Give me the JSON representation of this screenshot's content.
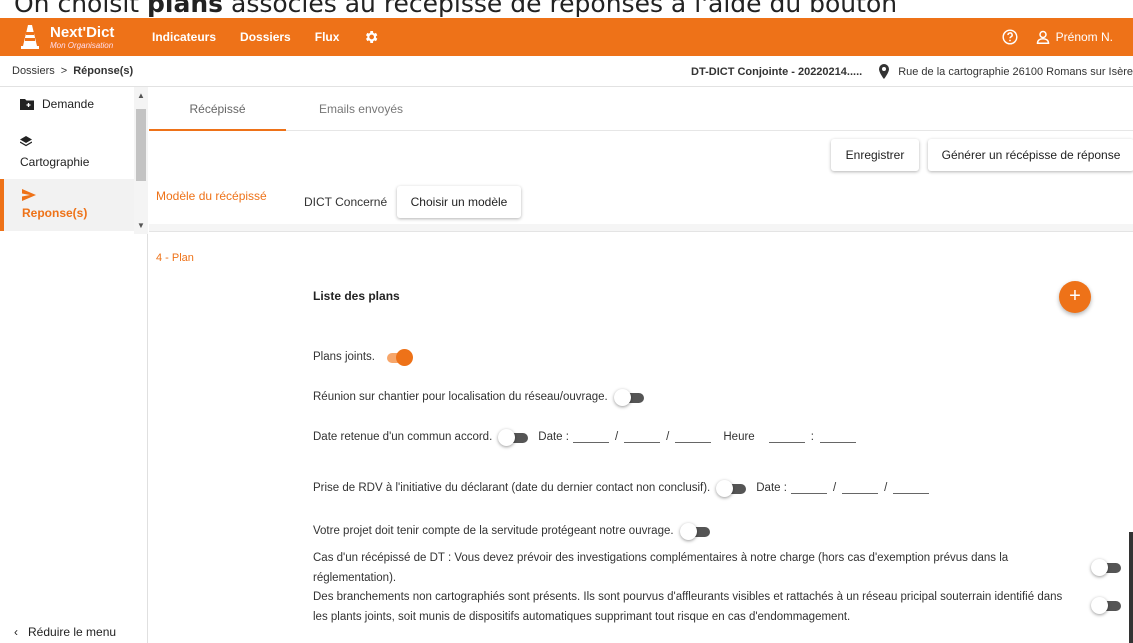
{
  "caption": {
    "before": "On choisit ",
    "bold": "plans",
    "after": " associés au récépissé de réponses à l'aide du bouton"
  },
  "topbar": {
    "logo_name": "Next'Dict",
    "logo_org": "Mon Organisation",
    "nav": [
      "Indicateurs",
      "Dossiers",
      "Flux"
    ],
    "user": "Prénom N."
  },
  "breadcrumb": {
    "root": "Dossiers",
    "sep": ">",
    "current": "Réponse(s)",
    "dict_title": "DT-DICT Conjointe - 20220214.....",
    "address": "Rue de la cartographie 26100 Romans sur Isère"
  },
  "sidebar": {
    "items": [
      {
        "label": "Demande"
      },
      {
        "label": "Cartographie"
      },
      {
        "label": "Reponse(s)"
      }
    ],
    "reduce_label": "Réduire le menu"
  },
  "tabs": [
    {
      "label": "Récépissé",
      "active": true
    },
    {
      "label": "Emails envoyés",
      "active": false
    }
  ],
  "actions": {
    "save": "Enregistrer",
    "generate": "Générer un récépisse de réponse"
  },
  "modele": {
    "label": "Modèle du récépissé",
    "dict_concerne": "DICT Concerné",
    "choose": "Choisir un modèle"
  },
  "plan": {
    "section_label": "4 - Plan",
    "list_title": "Liste des plans",
    "add": "+",
    "plans_joints": "Plans joints.",
    "reunion": "Réunion sur chantier pour localisation du réseau/ouvrage.",
    "date_retenue": "Date retenue d'un commun accord.",
    "date_label": "Date :",
    "date_sep": "/",
    "heure_label": "Heure",
    "heure_sep": ":",
    "prise_rdv": "Prise de RDV à l'initiative du déclarant (date du dernier contact non conclusif).",
    "servitude": "Votre projet doit tenir compte de la servitude protégeant notre ouvrage.",
    "cas_dt": "Cas d'un récépissé de DT : Vous devez prévoir des investigations complémentaires à notre charge (hors cas d'exemption prévus dans la réglementation).",
    "branchements": "Des branchements non cartographiés sont présents. Ils sont pourvus d'affleurants visibles et rattachés à un réseau pricipal souterrain identifié dans les plants joints, soit munis de dispositifs automatiques supprimant tout risque en cas d'endommagement."
  },
  "toggles": {
    "plans_joints": true,
    "reunion": false,
    "date_retenue": false,
    "prise_rdv": false,
    "servitude": false,
    "cas_dt": false,
    "branchements": false
  },
  "colors": {
    "accent": "#ee7218"
  }
}
